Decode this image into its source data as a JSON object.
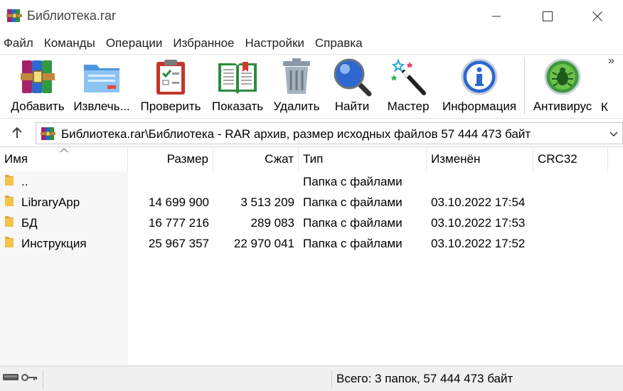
{
  "window": {
    "title": "Библиотека.rar"
  },
  "menu": {
    "items": [
      "Файл",
      "Команды",
      "Операции",
      "Избранное",
      "Настройки",
      "Справка"
    ]
  },
  "toolbar": {
    "buttons": [
      {
        "label": "Добавить",
        "icon": "archive-books-icon"
      },
      {
        "label": "Извлечь...",
        "icon": "folder-extract-icon"
      },
      {
        "label": "Проверить",
        "icon": "clipboard-check-icon"
      },
      {
        "label": "Показать",
        "icon": "open-book-icon"
      },
      {
        "label": "Удалить",
        "icon": "trash-can-icon"
      },
      {
        "label": "Найти",
        "icon": "magnifier-icon"
      },
      {
        "label": "Мастер",
        "icon": "magic-wand-icon"
      },
      {
        "label": "Информация",
        "icon": "info-icon"
      },
      {
        "label": "Антивирус",
        "icon": "virus-scan-icon"
      },
      {
        "label": "К",
        "icon": ""
      }
    ],
    "more": "»"
  },
  "address": {
    "path": "Библиотека.rar\\Библиотека - RAR архив, размер исходных файлов 57 444 473 байт"
  },
  "columns": {
    "name": "Имя",
    "size": "Размер",
    "packed": "Сжат",
    "type": "Тип",
    "modified": "Изменён",
    "crc": "CRC32"
  },
  "rows": [
    {
      "name": "..",
      "size": "",
      "packed": "",
      "type": "Папка с файлами",
      "modified": "",
      "crc": ""
    },
    {
      "name": "LibraryApp",
      "size": "14 699 900",
      "packed": "3 513 209",
      "type": "Папка с файлами",
      "modified": "03.10.2022 17:54",
      "crc": ""
    },
    {
      "name": "БД",
      "size": "16 777 216",
      "packed": "289 083",
      "type": "Папка с файлами",
      "modified": "03.10.2022 17:53",
      "crc": ""
    },
    {
      "name": "Инструкция",
      "size": "25 967 357",
      "packed": "22 970 041",
      "type": "Папка с файлами",
      "modified": "03.10.2022 17:52",
      "crc": ""
    }
  ],
  "status": {
    "text": "Всего: 3 папок, 57 444 473 байт"
  },
  "colors": {
    "folder": "#f3c34a",
    "folder_dark": "#dba63a",
    "name_column_bg": "#f7f7f7",
    "statusbar_bg": "#f0f0f0"
  }
}
